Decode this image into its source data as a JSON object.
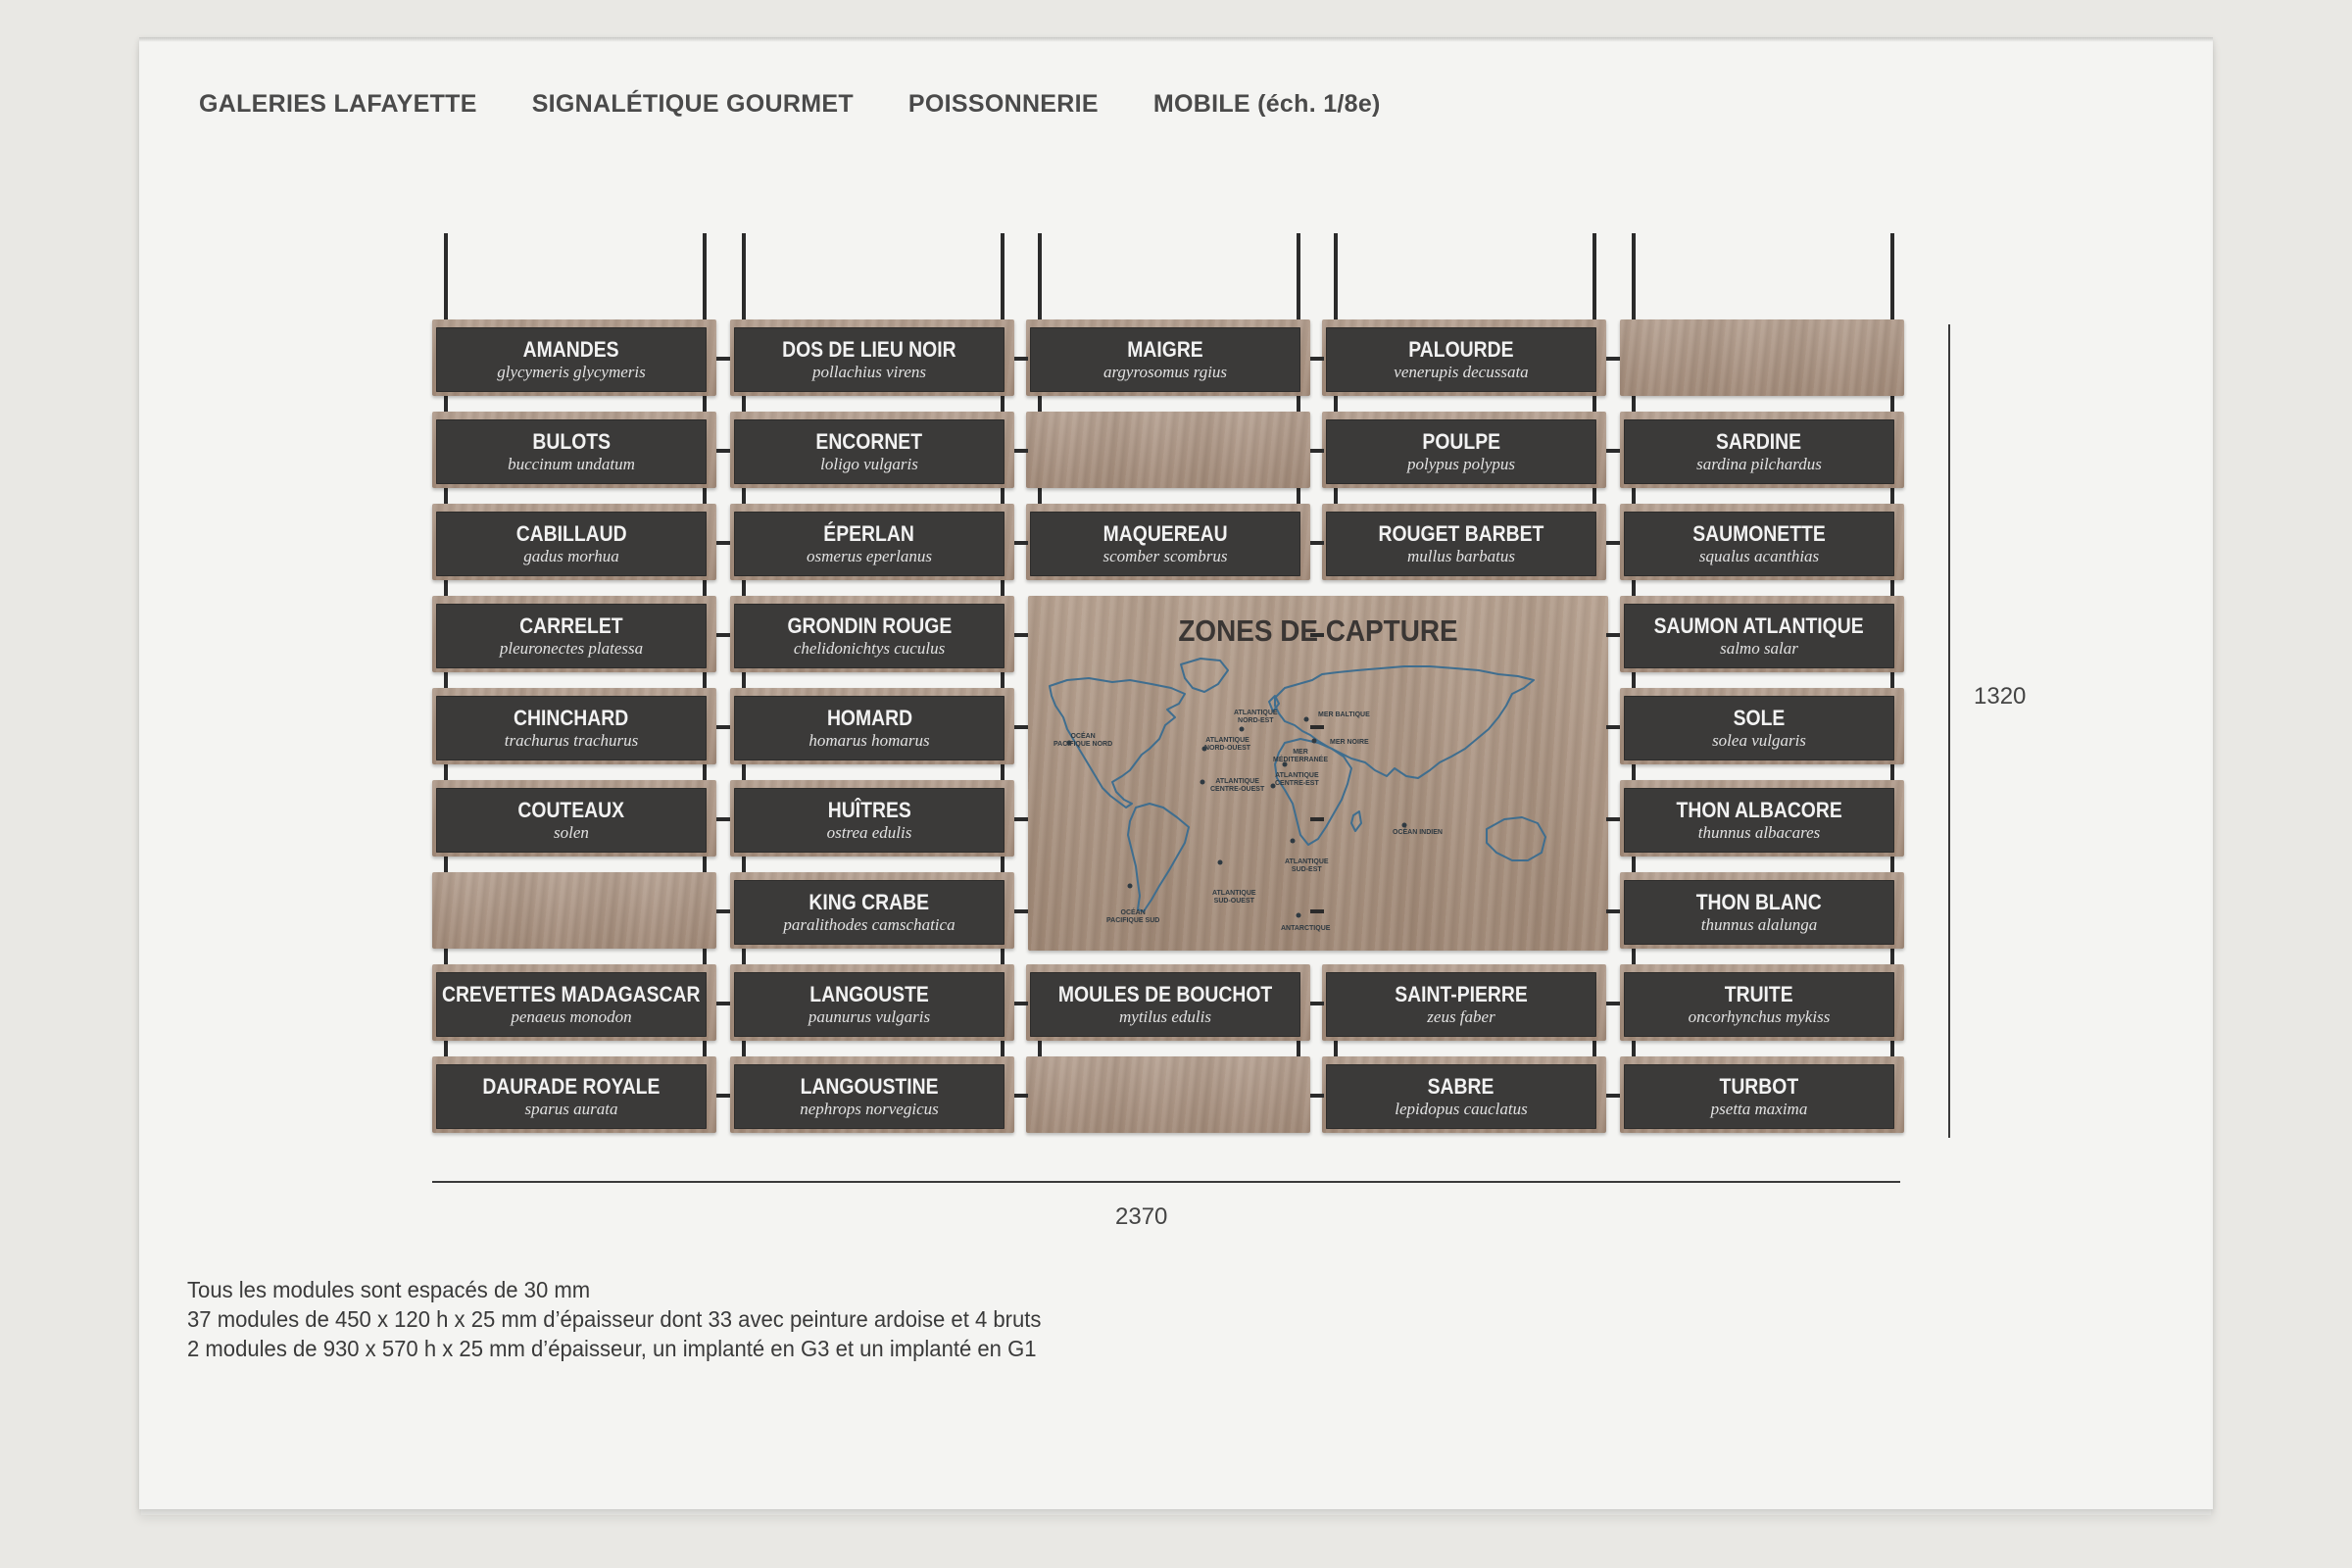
{
  "header": {
    "client": "GALERIES LAFAYETTE",
    "project": "SIGNALÉTIQUE GOURMET",
    "section": "POISSONNERIE",
    "item": "MOBILE (éch. 1/8e)"
  },
  "map": {
    "title": "ZONES DE CAPTURE",
    "zones": [
      "OCÉAN\nPACIFIQUE NORD",
      "ATLANTIQUE\nNORD-EST",
      "MER BALTIQUE",
      "ATLANTIQUE\nNORD-OUEST",
      "MER NOIRE",
      "MER\nMÉDITERRANÉE",
      "ATLANTIQUE\nCENTRE-OUEST",
      "ATLANTIQUE\nCENTRE-EST",
      "OCÉAN INDIEN",
      "ATLANTIQUE\nSUD-EST",
      "ATLANTIQUE\nSUD-OUEST",
      "OCÉAN\nPACIFIQUE SUD",
      "ANTARCTIQUE"
    ]
  },
  "columns": [
    [
      {
        "name": "AMANDES",
        "latin": "glycymeris glycymeris"
      },
      {
        "name": "BULOTS",
        "latin": "buccinum undatum"
      },
      {
        "name": "CABILLAUD",
        "latin": "gadus morhua"
      },
      {
        "name": "CARRELET",
        "latin": "pleuronectes platessa"
      },
      {
        "name": "CHINCHARD",
        "latin": "trachurus trachurus"
      },
      {
        "name": "COUTEAUX",
        "latin": "solen"
      },
      {
        "name": "",
        "latin": ""
      },
      {
        "name": "CREVETTES MADAGASCAR",
        "latin": "penaeus monodon"
      },
      {
        "name": "DAURADE ROYALE",
        "latin": "sparus aurata"
      }
    ],
    [
      {
        "name": "DOS DE LIEU NOIR",
        "latin": "pollachius virens"
      },
      {
        "name": "ENCORNET",
        "latin": "loligo vulgaris"
      },
      {
        "name": "ÉPERLAN",
        "latin": "osmerus eperlanus"
      },
      {
        "name": "GRONDIN ROUGE",
        "latin": "chelidonichtys cuculus"
      },
      {
        "name": "HOMARD",
        "latin": "homarus homarus"
      },
      {
        "name": "HUÎTRES",
        "latin": "ostrea edulis"
      },
      {
        "name": "KING CRABE",
        "latin": "paralithodes camschatica"
      },
      {
        "name": "LANGOUSTE",
        "latin": "paunurus vulgaris"
      },
      {
        "name": "LANGOUSTINE",
        "latin": "nephrops norvegicus"
      }
    ],
    [
      {
        "name": "MAIGRE",
        "latin": "argyrosomus rgius"
      },
      {
        "name": "",
        "latin": ""
      },
      {
        "name": "MAQUEREAU",
        "latin": "scomber scombrus"
      },
      {
        "name": "MOULES DE BOUCHOT",
        "latin": "mytilus edulis"
      },
      {
        "name": "",
        "latin": ""
      }
    ],
    [
      {
        "name": "PALOURDE",
        "latin": "venerupis decussata"
      },
      {
        "name": "POULPE",
        "latin": "polypus polypus"
      },
      {
        "name": "ROUGET BARBET",
        "latin": "mullus barbatus"
      },
      {
        "name": "SAINT-PIERRE",
        "latin": "zeus faber"
      },
      {
        "name": "SABRE",
        "latin": "lepidopus cauclatus"
      }
    ],
    [
      {
        "name": "",
        "latin": ""
      },
      {
        "name": "SARDINE",
        "latin": "sardina pilchardus"
      },
      {
        "name": "SAUMONETTE",
        "latin": "squalus acanthias"
      },
      {
        "name": "SAUMON ATLANTIQUE",
        "latin": "salmo salar"
      },
      {
        "name": "SOLE",
        "latin": "solea vulgaris"
      },
      {
        "name": "THON ALBACORE",
        "latin": "thunnus albacares"
      },
      {
        "name": "THON BLANC",
        "latin": "thunnus alalunga"
      },
      {
        "name": "TRUITE",
        "latin": "oncorhynchus mykiss"
      },
      {
        "name": "TURBOT",
        "latin": "psetta maxima"
      }
    ]
  ],
  "dimensions": {
    "height": "1320",
    "width": "2370"
  },
  "notes": [
    "Tous les modules sont espacés de 30 mm",
    "37 modules de 450 x 120 h x 25 mm  d’épaisseur dont 33 avec peinture ardoise et 4 bruts",
    "2 modules de 930 x 570 h x 25 mm d’épaisseur, un implanté en G3 et un implanté en G1"
  ],
  "colors": {
    "slate": "#3b3a39",
    "wood": "#ad9684",
    "map_outline": "#3f6e8f",
    "paper": "#f4f4f2"
  }
}
